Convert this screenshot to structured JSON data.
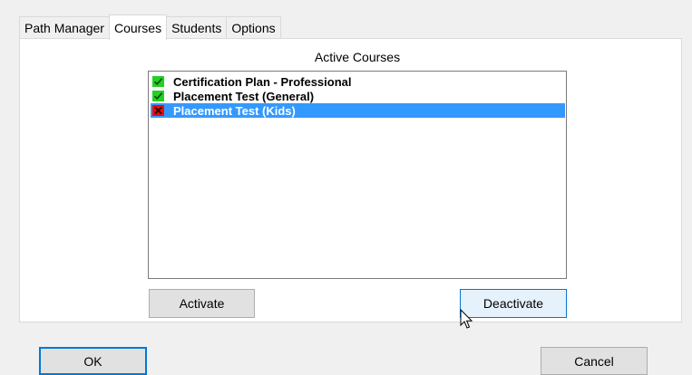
{
  "tabs": [
    {
      "label": "Path Manager",
      "active": false
    },
    {
      "label": "Courses",
      "active": true
    },
    {
      "label": "Students",
      "active": false
    },
    {
      "label": "Options",
      "active": false
    }
  ],
  "courses_page": {
    "list_title": "Active Courses",
    "items": [
      {
        "label": "Certification Plan - Professional",
        "status": "active",
        "icon": "check-icon",
        "selected": false
      },
      {
        "label": "Placement Test (General)",
        "status": "active",
        "icon": "check-icon",
        "selected": false
      },
      {
        "label": "Placement Test (Kids)",
        "status": "inactive",
        "icon": "cross-icon",
        "selected": true
      }
    ],
    "activate_label": "Activate",
    "deactivate_label": "Deactivate"
  },
  "footer": {
    "ok_label": "OK",
    "cancel_label": "Cancel"
  },
  "colors": {
    "selection": "#3399ff",
    "active_icon": "#24d024",
    "inactive_icon": "#e80c0c",
    "focus_border": "#0078d7"
  }
}
